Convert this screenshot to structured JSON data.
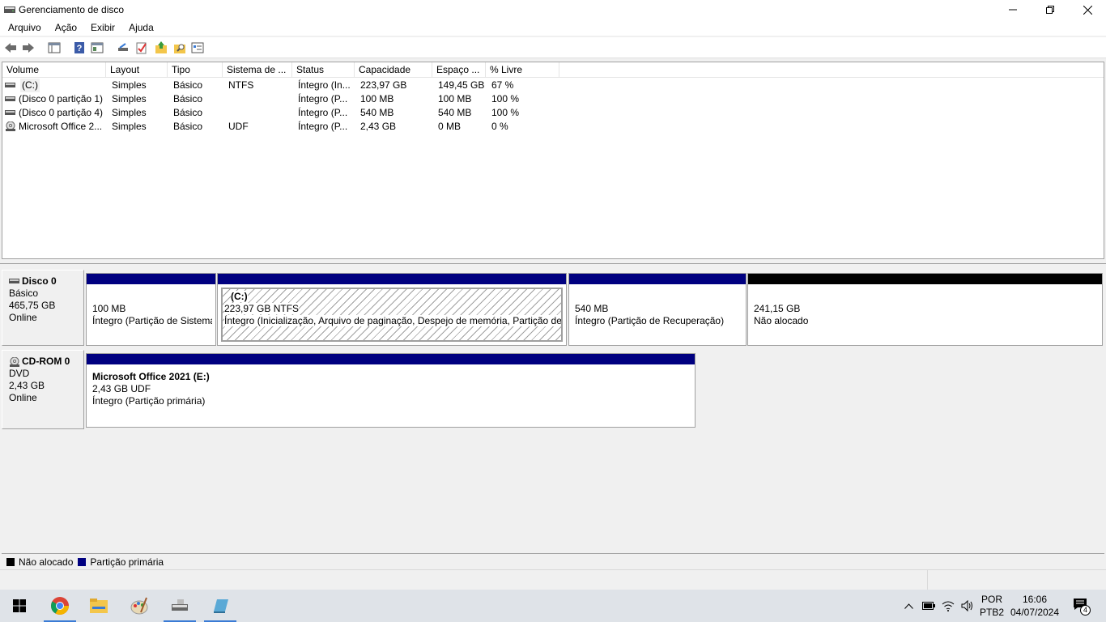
{
  "window": {
    "title": "Gerenciamento de disco"
  },
  "menu": [
    "Arquivo",
    "Ação",
    "Exibir",
    "Ajuda"
  ],
  "toolbar": {
    "icons": [
      "back-icon",
      "forward-icon",
      "console-tree-icon",
      "help-icon",
      "properties-icon",
      "connect-icon",
      "check-icon",
      "up-folder-icon",
      "search-folder-icon",
      "view-icon"
    ]
  },
  "volume_list": {
    "columns": [
      "Volume",
      "Layout",
      "Tipo",
      "Sistema de ...",
      "Status",
      "Capacidade",
      "Espaço ...",
      "% Livre"
    ],
    "rows": [
      {
        "icon": "drive-icon",
        "volume": "(C:)",
        "layout": "Simples",
        "tipo": "Básico",
        "fs": "NTFS",
        "status": "Íntegro (In...",
        "capacidade": "223,97 GB",
        "espaco": "149,45 GB",
        "livre": "67 %"
      },
      {
        "icon": "drive-icon",
        "volume": "(Disco 0 partição 1)",
        "layout": "Simples",
        "tipo": "Básico",
        "fs": "",
        "status": "Íntegro (P...",
        "capacidade": "100 MB",
        "espaco": "100 MB",
        "livre": "100 %"
      },
      {
        "icon": "drive-icon",
        "volume": "(Disco 0 partição 4)",
        "layout": "Simples",
        "tipo": "Básico",
        "fs": "",
        "status": "Íntegro (P...",
        "capacidade": "540 MB",
        "espaco": "540 MB",
        "livre": "100 %"
      },
      {
        "icon": "cdrom-icon",
        "volume": "Microsoft Office 2...",
        "layout": "Simples",
        "tipo": "Básico",
        "fs": "UDF",
        "status": "Íntegro (P...",
        "capacidade": "2,43 GB",
        "espaco": "0 MB",
        "livre": "0 %"
      }
    ]
  },
  "disks": [
    {
      "name": "Disco 0",
      "type": "Básico",
      "size": "465,75 GB",
      "state": "Online",
      "partitions": [
        {
          "title": "",
          "size": "100 MB",
          "desc": "Íntegro (Partição de Sistema",
          "color": "#000080"
        },
        {
          "title": "(C:)",
          "size": "223,97 GB NTFS",
          "desc": "Íntegro (Inicialização, Arquivo de paginação, Despejo de memória, Partição de D",
          "color": "#000080"
        },
        {
          "title": "",
          "size": "540 MB",
          "desc": "Íntegro (Partição de Recuperação)",
          "color": "#000080"
        },
        {
          "title": "",
          "size": "241,15 GB",
          "desc": "Não alocado",
          "color": "#000000"
        }
      ]
    },
    {
      "name": "CD-ROM 0",
      "type": "DVD",
      "size": "2,43 GB",
      "state": "Online",
      "partitions": [
        {
          "title": "Microsoft Office 2021  (E:)",
          "size": "2,43 GB UDF",
          "desc": "Íntegro (Partição primária)",
          "color": "#000080"
        }
      ]
    }
  ],
  "legend": [
    {
      "label": "Não alocado",
      "color": "#000000"
    },
    {
      "label": "Partição primária",
      "color": "#000080"
    }
  ],
  "taskbar": {
    "apps": [
      "windows-start-icon",
      "chrome-icon",
      "file-explorer-icon",
      "paint-icon",
      "disk-management-icon",
      "app-icon"
    ],
    "lang_top": "POR",
    "lang_bottom": "PTB2",
    "time": "16:06",
    "date": "04/07/2024",
    "notifications": "4"
  }
}
